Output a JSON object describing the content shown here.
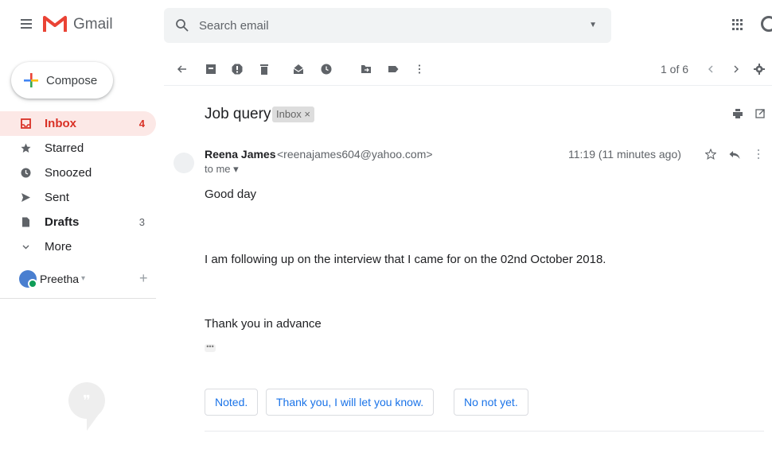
{
  "app": {
    "name": "Gmail"
  },
  "search": {
    "placeholder": "Search email"
  },
  "compose": {
    "label": "Compose"
  },
  "sidebar": {
    "items": [
      {
        "label": "Inbox",
        "count": "4",
        "icon": "inbox-icon"
      },
      {
        "label": "Starred",
        "count": "",
        "icon": "star-icon"
      },
      {
        "label": "Snoozed",
        "count": "",
        "icon": "clock-icon"
      },
      {
        "label": "Sent",
        "count": "",
        "icon": "send-icon"
      },
      {
        "label": "Drafts",
        "count": "3",
        "icon": "draft-icon"
      },
      {
        "label": "More",
        "count": "",
        "icon": "chevron-down-icon"
      }
    ]
  },
  "hangouts": {
    "user": "Preetha",
    "caret": "▾",
    "add": "+"
  },
  "toolbar": {
    "pager": "1 of 6"
  },
  "message": {
    "subject": "Job query",
    "label": "Inbox ×",
    "sender_name": "Reena James",
    "sender_email": "<reenajames604@yahoo.com>",
    "to": "to me ▾",
    "time": "11:19 (11 minutes ago)",
    "body": [
      "Good day",
      "I am following up on the interview that I came for on the 02nd October 2018.",
      "Thank you in advance"
    ],
    "ellipsis": "•••"
  },
  "smart_replies": [
    "Noted.",
    "Thank you, I will let you know.",
    "No not yet."
  ],
  "colors": {
    "accent_red": "#d93025",
    "link_blue": "#1a73e8",
    "active_bg": "#fce8e6"
  }
}
